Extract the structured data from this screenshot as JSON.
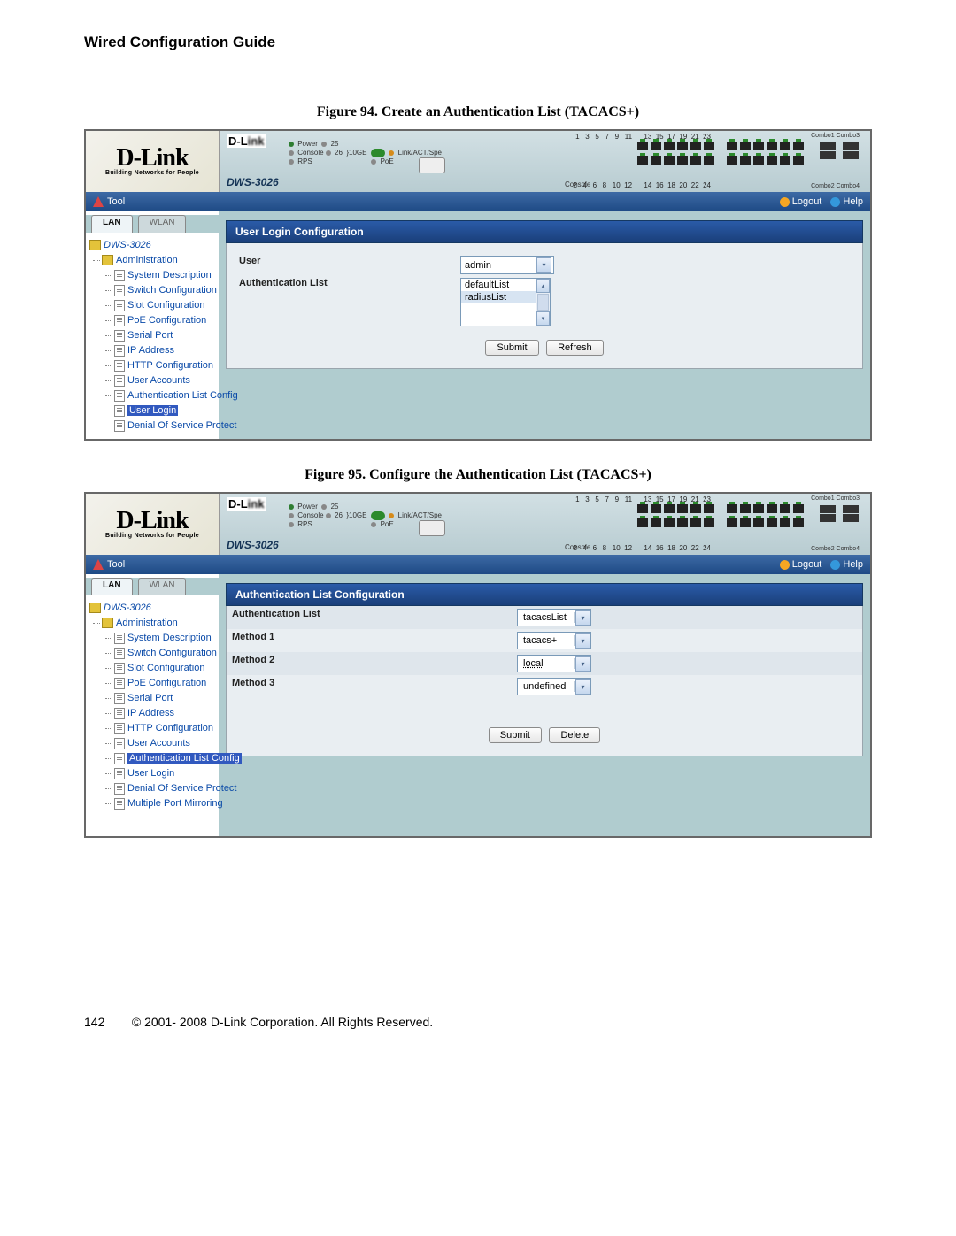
{
  "guide_title": "Wired Configuration Guide",
  "figure94": {
    "caption_prefix": "Figure 94. ",
    "caption": "Create an Authentication List (TACACS+)",
    "logo": "D-Link",
    "logo_tag": "Building Networks for People",
    "device_model": "DWS-3026",
    "console_label": "Console",
    "toolbar": {
      "tool": "Tool",
      "logout": "Logout",
      "help": "Help"
    },
    "tabs": {
      "lan": "LAN",
      "wlan": "WLAN"
    },
    "tree_root": "DWS-3026",
    "admin": "Administration",
    "items": [
      "System Description",
      "Switch Configuration",
      "Slot Configuration",
      "PoE Configuration",
      "Serial Port",
      "IP Address",
      "HTTP Configuration",
      "User Accounts",
      "Authentication List Config",
      "User Login",
      "Denial Of Service Protect"
    ],
    "panel_title": "User Login Configuration",
    "user_label": "User",
    "user_value": "admin",
    "authlist_label": "Authentication List",
    "list_options": [
      "defaultList",
      "radiusList"
    ],
    "buttons": {
      "submit": "Submit",
      "refresh": "Refresh"
    }
  },
  "figure95": {
    "caption_prefix": "Figure 95. ",
    "caption": "Configure the Authentication List (TACACS+)",
    "panel_title": "Authentication List Configuration",
    "tree_root": "DWS-3026",
    "admin": "Administration",
    "items": [
      "System Description",
      "Switch Configuration",
      "Slot Configuration",
      "PoE Configuration",
      "Serial Port",
      "IP Address",
      "HTTP Configuration",
      "User Accounts",
      "Authentication List Config",
      "User Login",
      "Denial Of Service Protect",
      "Multiple Port Mirroring"
    ],
    "rows": [
      {
        "label": "Authentication List",
        "value": "tacacsList"
      },
      {
        "label": "Method 1",
        "value": "tacacs+"
      },
      {
        "label": "Method 2",
        "value": "local"
      },
      {
        "label": "Method 3",
        "value": "undefined"
      }
    ],
    "buttons": {
      "submit": "Submit",
      "delete": "Delete"
    }
  },
  "footer": {
    "page": "142",
    "copyright": "© 2001- 2008 D-Link Corporation. All Rights Reserved."
  }
}
